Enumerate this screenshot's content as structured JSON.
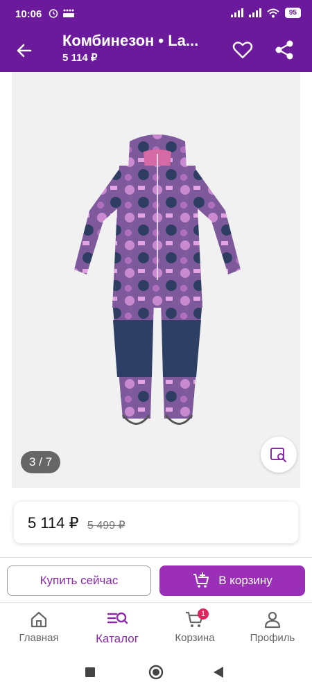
{
  "status": {
    "time": "10:06",
    "battery": "95"
  },
  "header": {
    "title": "Комбинезон • La...",
    "price": "5 114 ₽"
  },
  "gallery": {
    "counter": "3 / 7"
  },
  "price": {
    "current": "5 114 ₽",
    "old": "5 499 ₽"
  },
  "actions": {
    "buy_now": "Купить сейчас",
    "to_cart": "В корзину"
  },
  "nav": [
    {
      "label": "Главная"
    },
    {
      "label": "Каталог"
    },
    {
      "label": "Корзина",
      "badge": "1"
    },
    {
      "label": "Профиль"
    }
  ],
  "colors": {
    "brand": "#6a1a9a",
    "accent": "#9b2fb8",
    "badge": "#e0245e"
  },
  "icons": [
    "back-arrow-icon",
    "heart-icon",
    "share-icon",
    "image-search-icon",
    "cart-plus-icon",
    "home-icon",
    "catalog-search-icon",
    "cart-icon",
    "profile-icon"
  ]
}
